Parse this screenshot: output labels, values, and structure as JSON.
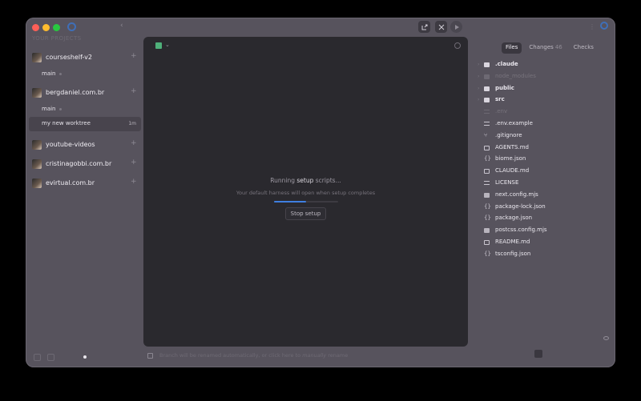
{
  "titlebar": {
    "back": "‹"
  },
  "sidebar": {
    "section_label": "YOUR PROJECTS",
    "projects": [
      {
        "name": "courseshelf-v2",
        "plus": "+",
        "branches": [
          {
            "label": "main"
          }
        ]
      },
      {
        "name": "bergdaniel.com.br",
        "plus": "+",
        "branches": [
          {
            "label": "main"
          },
          {
            "label": "my new worktree",
            "meta": "1m"
          }
        ]
      },
      {
        "name": "youtube-videos",
        "plus": "+"
      },
      {
        "name": "cristinagobbi.com.br",
        "plus": "+"
      },
      {
        "name": "evirtual.com.br",
        "plus": "+"
      }
    ]
  },
  "main": {
    "tab_chevron": "⌄",
    "setup_title_prefix": "Running ",
    "setup_title_bold": "setup",
    "setup_title_suffix": " scripts...",
    "setup_subtitle": "Your default harness will open when setup completes",
    "progress_fraction": 0.5,
    "stop_label": "Stop setup",
    "status_text_a": "Branch will be renamed automatically, or click here to ",
    "status_text_em": "manually",
    "status_text_b": " rename"
  },
  "files_panel": {
    "tabs": [
      {
        "label": "Files",
        "active": true
      },
      {
        "label": "Changes",
        "count": "46"
      },
      {
        "label": "Checks"
      }
    ],
    "entries": [
      {
        "name": ".claude",
        "type": "folder",
        "chevron": "›"
      },
      {
        "name": "node_modules",
        "type": "folder",
        "chevron": "›",
        "dim": true
      },
      {
        "name": "public",
        "type": "folder",
        "chevron": "›"
      },
      {
        "name": "src",
        "type": "folder",
        "chevron": "›"
      },
      {
        "name": ".env",
        "type": "lines",
        "dim": true
      },
      {
        "name": ".env.example",
        "type": "lines"
      },
      {
        "name": ".gitignore",
        "type": "git"
      },
      {
        "name": "AGENTS.md",
        "type": "book"
      },
      {
        "name": "biome.json",
        "type": "braces"
      },
      {
        "name": "CLAUDE.md",
        "type": "book"
      },
      {
        "name": "LICENSE",
        "type": "lines"
      },
      {
        "name": "next.config.mjs",
        "type": "img"
      },
      {
        "name": "package-lock.json",
        "type": "braces"
      },
      {
        "name": "package.json",
        "type": "braces"
      },
      {
        "name": "postcss.config.mjs",
        "type": "img"
      },
      {
        "name": "README.md",
        "type": "book"
      },
      {
        "name": "tsconfig.json",
        "type": "braces"
      }
    ]
  }
}
